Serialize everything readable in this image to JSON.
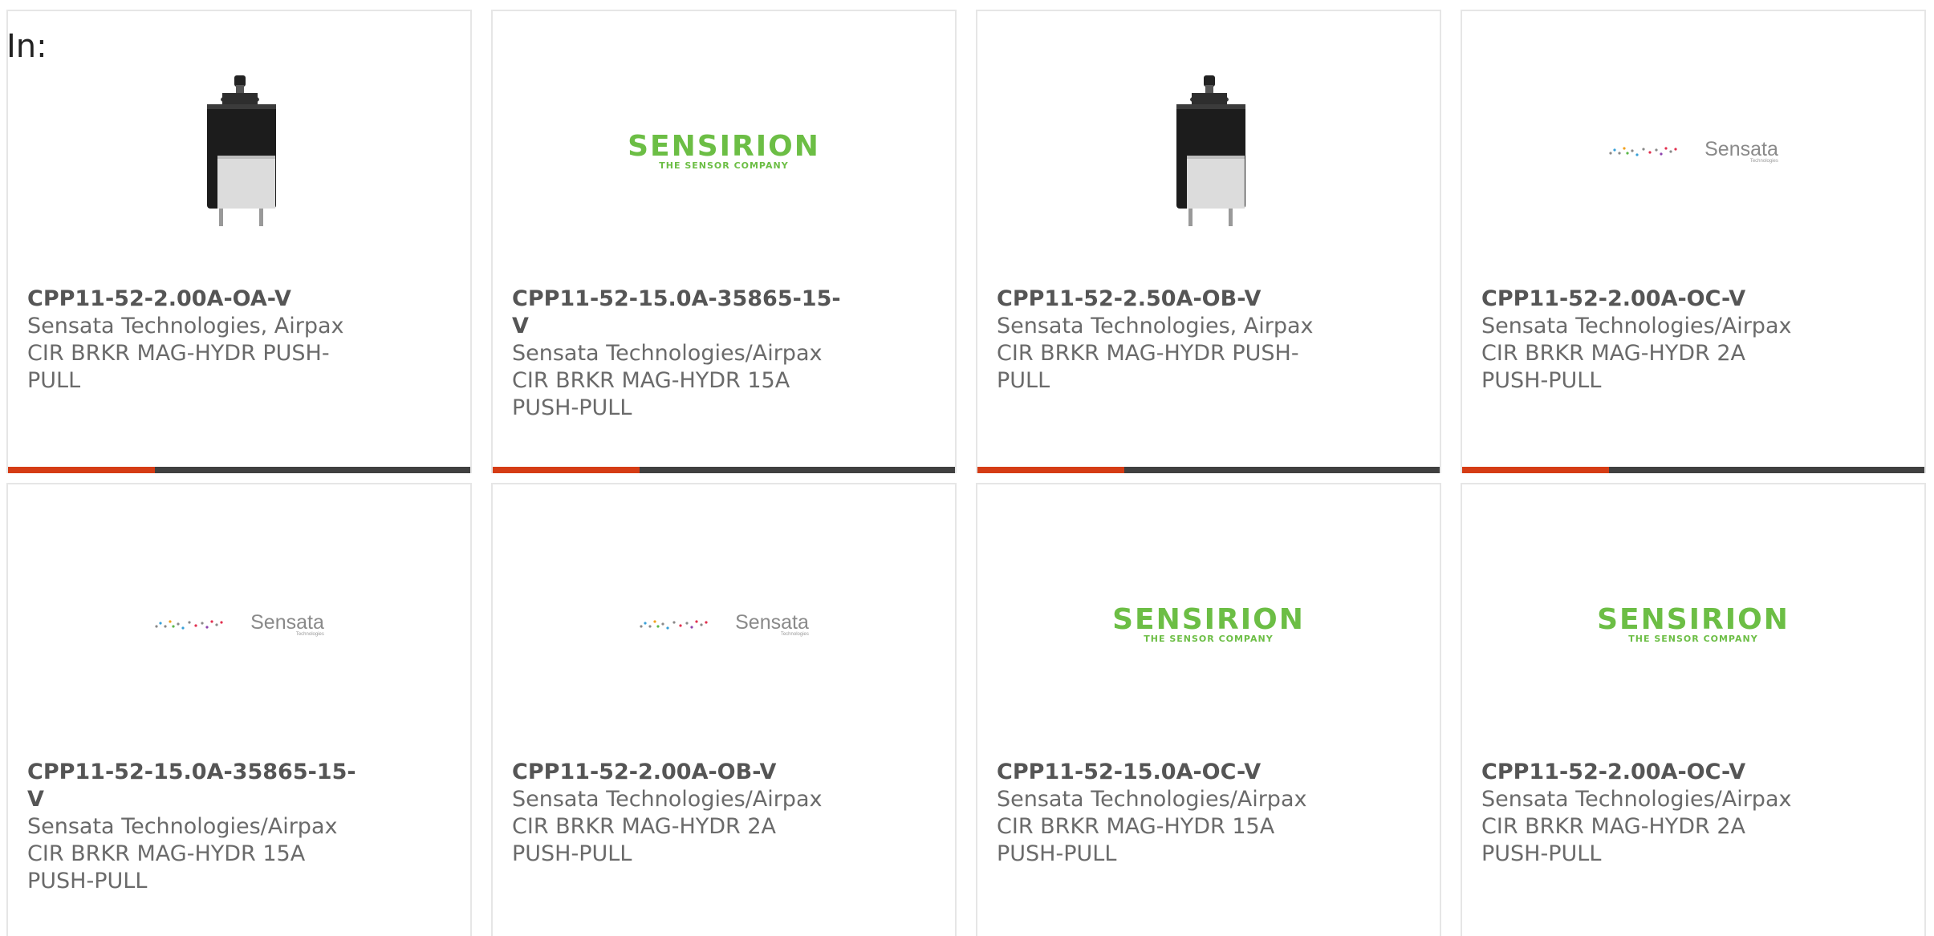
{
  "filter": {
    "label": "In:"
  },
  "logos": {
    "sensirion": {
      "name": "SENSIRION",
      "tagline": "THE SENSOR COMPANY"
    },
    "sensata": {
      "name": "Sensata",
      "tagline": "Technologies"
    }
  },
  "colors": {
    "accent": "#d53c15",
    "bar": "#404040",
    "sensirion_green": "#6cbe45"
  },
  "products": [
    {
      "part_number": "CPP11-52-2.00A-OA-V",
      "manufacturer": "Sensata Technologies, Airpax",
      "description": "CIR BRKR MAG-HYDR PUSH-PULL",
      "image": "circuit-breaker"
    },
    {
      "part_number": "CPP11-52-15.0A-35865-15-V",
      "manufacturer": "Sensata Technologies/Airpax",
      "description": "CIR BRKR MAG-HYDR 15A PUSH-PULL",
      "image": "sensirion-logo"
    },
    {
      "part_number": "CPP11-52-2.50A-OB-V",
      "manufacturer": "Sensata Technologies, Airpax",
      "description": "CIR BRKR MAG-HYDR PUSH-PULL",
      "image": "circuit-breaker"
    },
    {
      "part_number": "CPP11-52-2.00A-OC-V",
      "manufacturer": "Sensata Technologies/Airpax",
      "description": "CIR BRKR MAG-HYDR 2A PUSH-PULL",
      "image": "sensata-logo"
    },
    {
      "part_number": "CPP11-52-15.0A-35865-15-V",
      "manufacturer": "Sensata Technologies/Airpax",
      "description": "CIR BRKR MAG-HYDR 15A PUSH-PULL",
      "image": "sensata-logo"
    },
    {
      "part_number": "CPP11-52-2.00A-OB-V",
      "manufacturer": "Sensata Technologies/Airpax",
      "description": "CIR BRKR MAG-HYDR 2A PUSH-PULL",
      "image": "sensata-logo"
    },
    {
      "part_number": "CPP11-52-15.0A-OC-V",
      "manufacturer": "Sensata Technologies/Airpax",
      "description": "CIR BRKR MAG-HYDR 15A PUSH-PULL",
      "image": "sensirion-logo"
    },
    {
      "part_number": "CPP11-52-2.00A-OC-V",
      "manufacturer": "Sensata Technologies/Airpax",
      "description": "CIR BRKR MAG-HYDR 2A PUSH-PULL",
      "image": "sensirion-logo"
    }
  ]
}
